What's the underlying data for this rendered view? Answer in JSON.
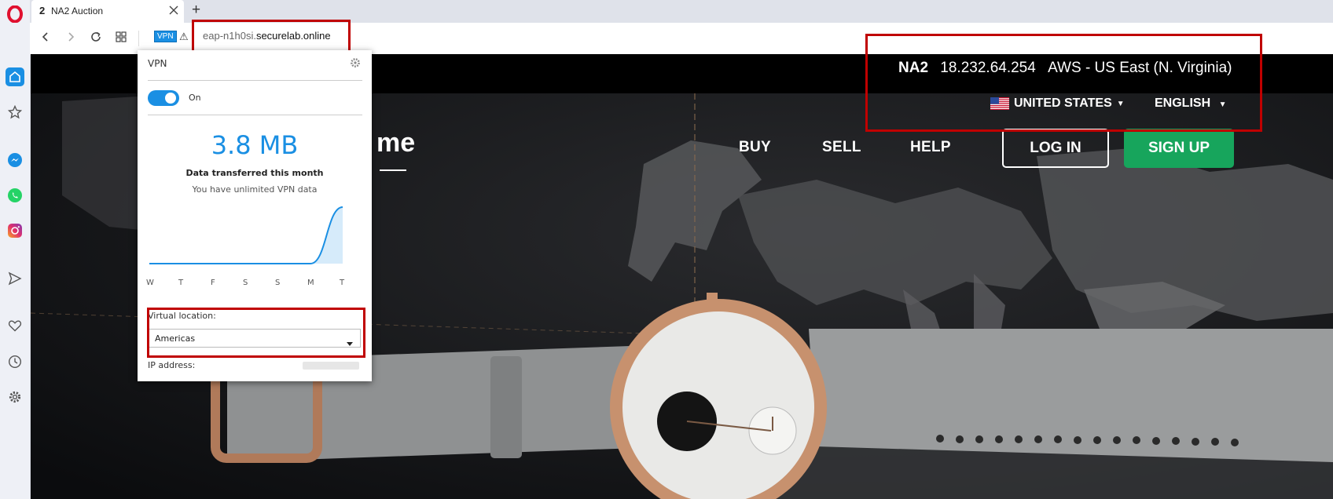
{
  "browser": {
    "tab": {
      "badge": "2",
      "title": "NA2 Auction"
    },
    "new_tab_glyph": "+",
    "vpn_badge": "VPN",
    "warning_glyph": "⚠",
    "url": {
      "prefix": "eap-n1h0si.",
      "domain": "securelab.online"
    }
  },
  "sidebar": {
    "icons": [
      "opera-logo-icon",
      "home-icon",
      "star-icon",
      "messenger-icon",
      "whatsapp-icon",
      "instagram-icon",
      "send-icon",
      "heart-icon",
      "history-icon",
      "settings-icon"
    ]
  },
  "site": {
    "server_name": "NA2",
    "ip": "18.232.64.254",
    "region": "AWS - US East (N. Virginia)",
    "country": "UNITED STATES",
    "language": "ENGLISH",
    "logo_partial": "me",
    "nav": {
      "buy": "BUY",
      "sell": "SELL",
      "help": "HELP",
      "login": "LOG IN",
      "signup": "SIGN UP"
    },
    "colors": {
      "signup_bg": "#17a55c",
      "topbar_bg": "#000000"
    }
  },
  "vpn_popup": {
    "title": "VPN",
    "toggle_label": "On",
    "toggle_on": true,
    "data_amount": "3.8 MB",
    "data_caption": "Data transferred this month",
    "unlimited_text": "You have unlimited VPN data",
    "days": [
      "W",
      "T",
      "F",
      "S",
      "S",
      "M",
      "T"
    ],
    "usage_values": [
      0,
      0,
      0,
      0,
      0,
      0,
      3.8
    ],
    "virtual_location_label": "Virtual location:",
    "virtual_location_value": "Americas",
    "ip_label": "IP address:",
    "colors": {
      "accent": "#1a8fe3"
    }
  }
}
